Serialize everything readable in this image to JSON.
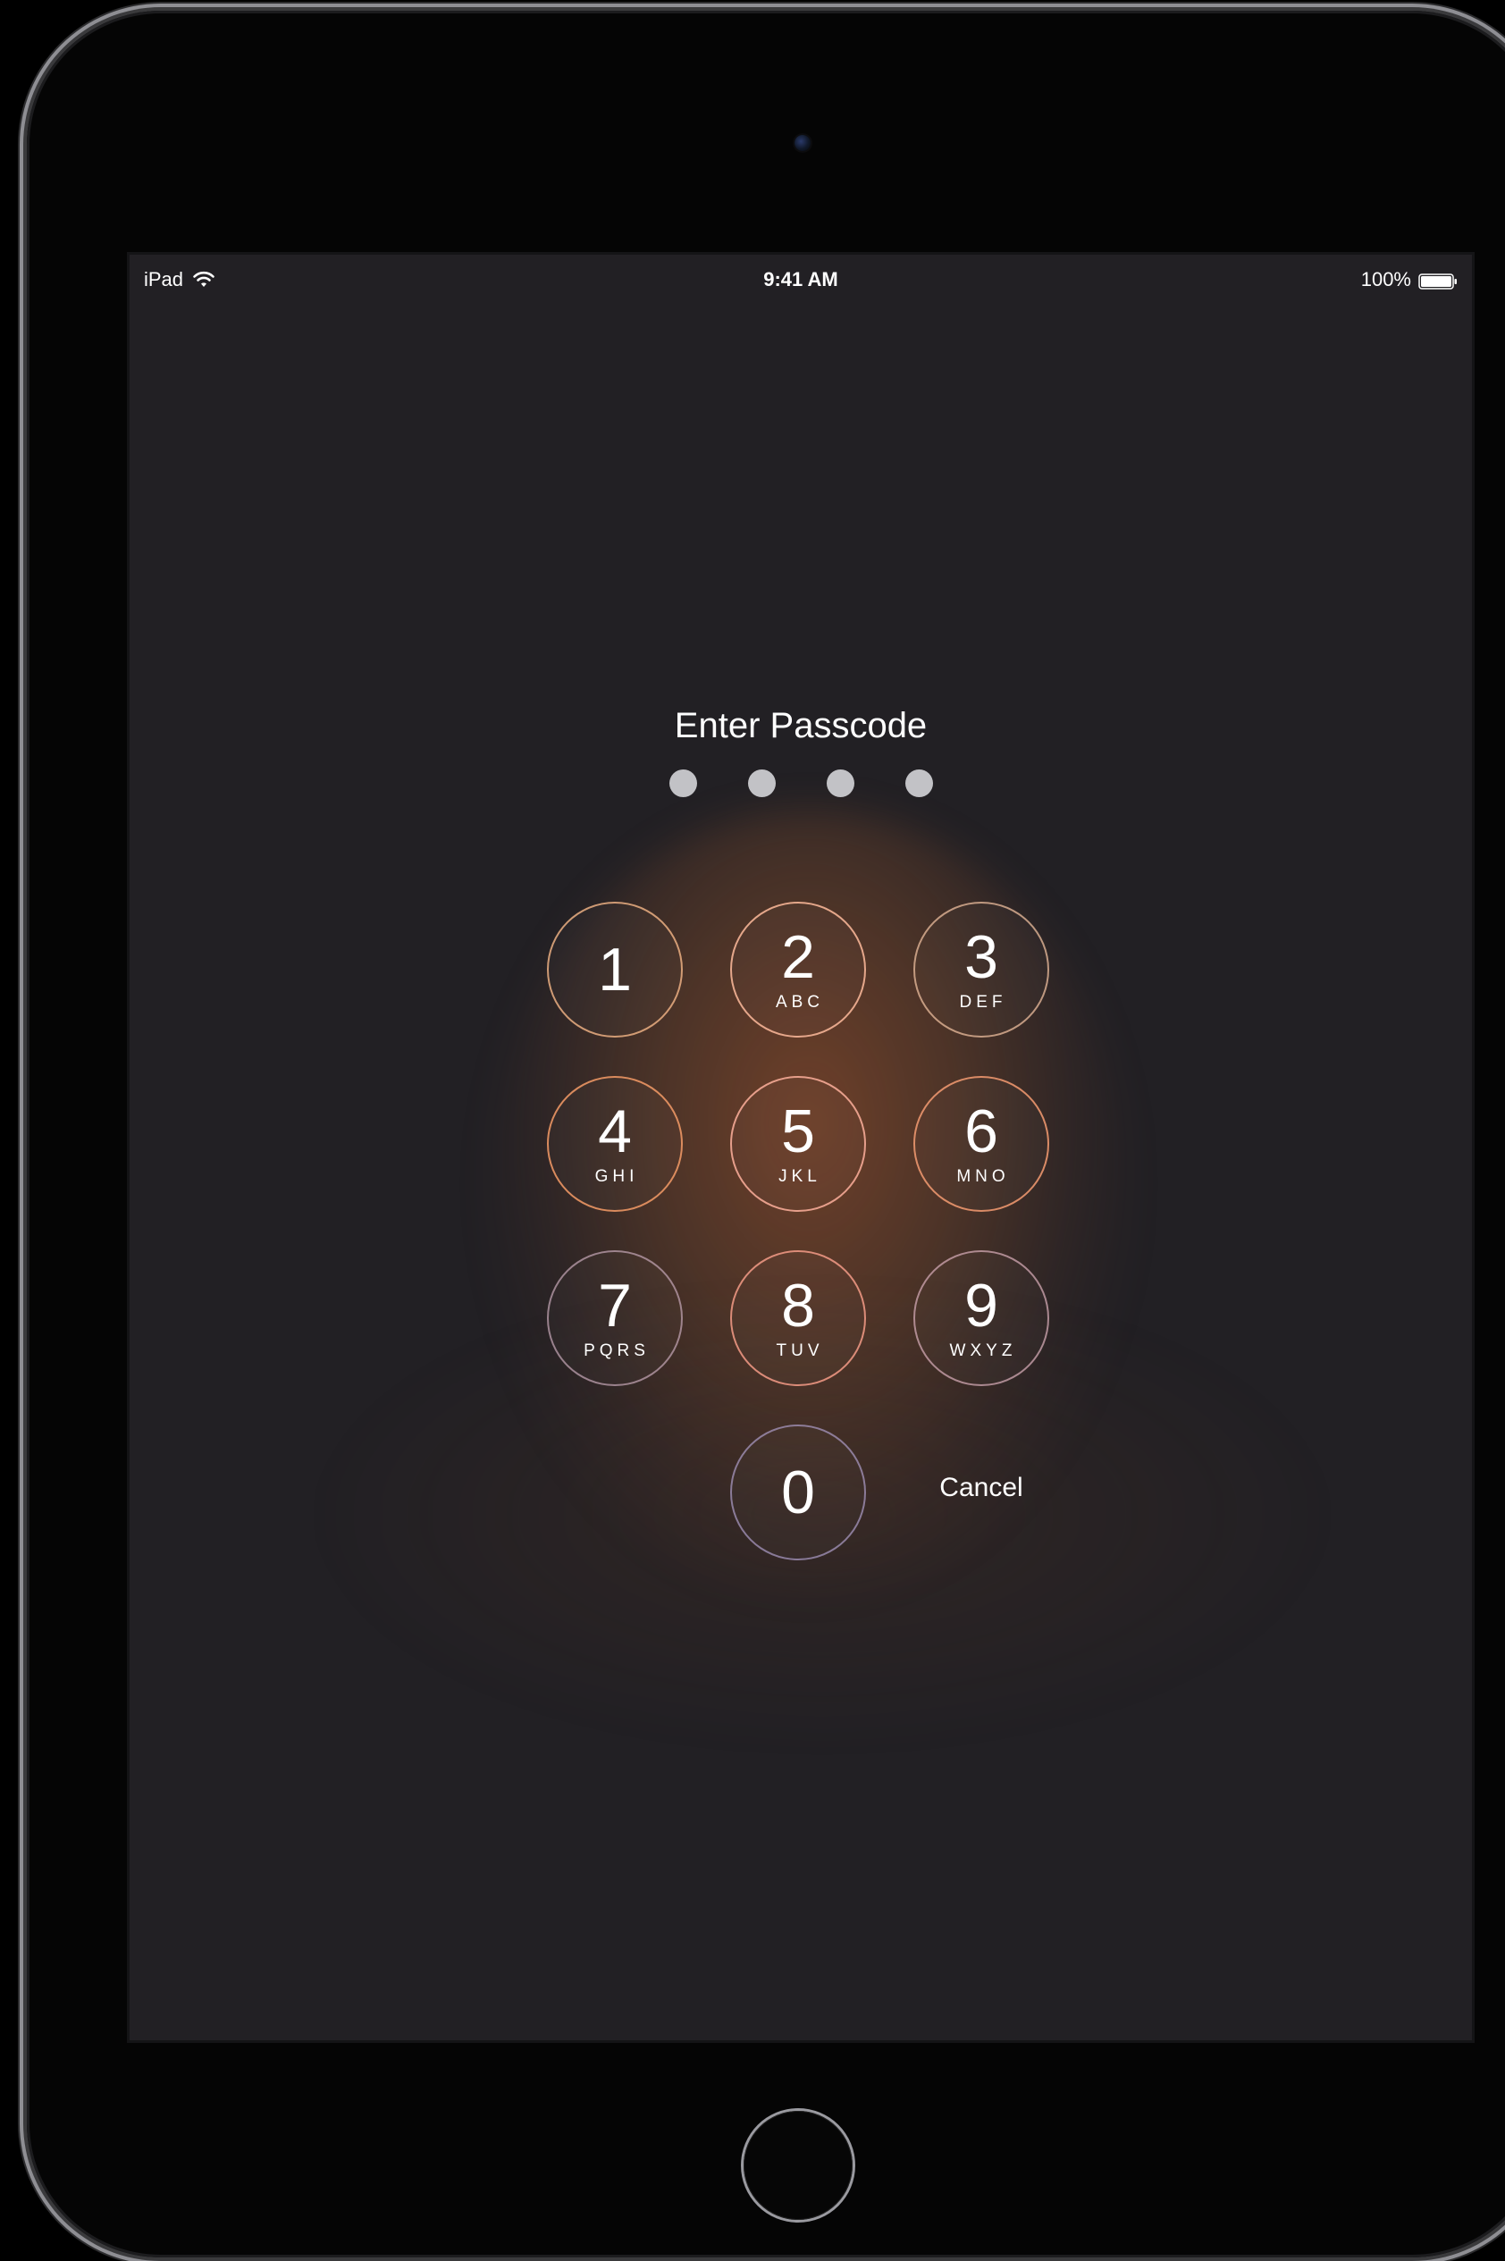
{
  "status_bar": {
    "device_name": "iPad",
    "time": "9:41 AM",
    "battery_percent": "100%",
    "battery_level": 1.0
  },
  "passcode": {
    "title": "Enter Passcode",
    "entered_digits": 0,
    "total_digits": 4
  },
  "keypad": {
    "keys": [
      {
        "number": "1",
        "letters": ""
      },
      {
        "number": "2",
        "letters": "ABC"
      },
      {
        "number": "3",
        "letters": "DEF"
      },
      {
        "number": "4",
        "letters": "GHI"
      },
      {
        "number": "5",
        "letters": "JKL"
      },
      {
        "number": "6",
        "letters": "MNO"
      },
      {
        "number": "7",
        "letters": "PQRS"
      },
      {
        "number": "8",
        "letters": "TUV"
      },
      {
        "number": "9",
        "letters": "WXYZ"
      },
      {
        "number": "0",
        "letters": ""
      }
    ],
    "cancel_label": "Cancel"
  },
  "icons": {
    "wifi": "wifi-icon",
    "battery": "battery-icon",
    "camera": "camera-icon",
    "home": "home-button"
  }
}
